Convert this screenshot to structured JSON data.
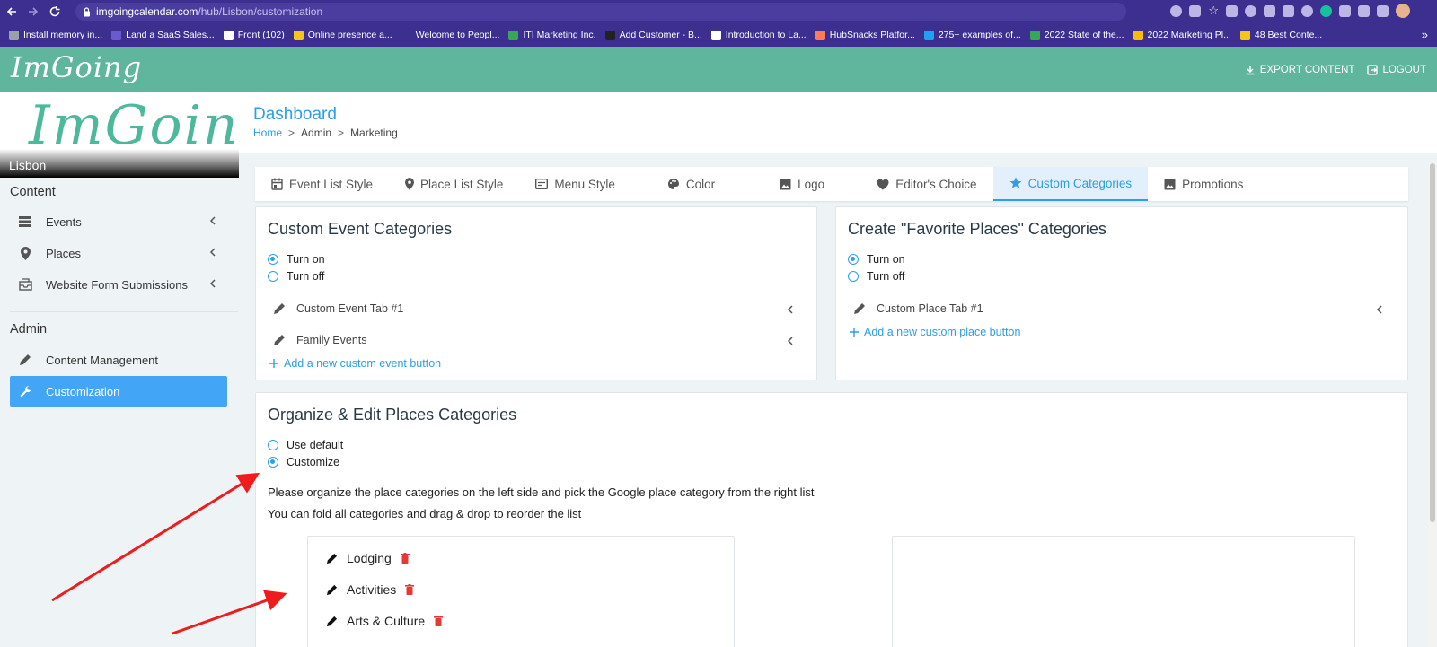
{
  "browser": {
    "url_host": "imgoingcalendar.com",
    "url_path": "/hub/Lisbon/customization",
    "bookmarks": [
      {
        "label": "Install memory in...",
        "color": "#9aa0a6"
      },
      {
        "label": "Land a SaaS Sales...",
        "color": "#6a5acd"
      },
      {
        "label": "Front (102)",
        "color": "#ffffff"
      },
      {
        "label": "Online presence a...",
        "color": "#f5c518"
      },
      {
        "label": "Welcome to Peopl...",
        "color": "#3c2f8f"
      },
      {
        "label": "ITI Marketing Inc.",
        "color": "#34a853"
      },
      {
        "label": "Add Customer - B...",
        "color": "#222222"
      },
      {
        "label": "Introduction to La...",
        "color": "#ffffff"
      },
      {
        "label": "HubSnacks Platfor...",
        "color": "#ff7a59"
      },
      {
        "label": "275+ examples of...",
        "color": "#1da1f2"
      },
      {
        "label": "2022 State of the...",
        "color": "#34a853"
      },
      {
        "label": "2022 Marketing Pl...",
        "color": "#fbbc04"
      },
      {
        "label": "48 Best Conte...",
        "color": "#f5c518"
      }
    ],
    "more": "»"
  },
  "app": {
    "brand": "ImGoing",
    "export_label": "EXPORT CONTENT",
    "logout_label": "LOGOUT"
  },
  "sidebar": {
    "logo_text": "ImGoing",
    "city": "Lisbon",
    "content_heading": "Content",
    "content_items": [
      {
        "label": "Events",
        "icon": "list-icon"
      },
      {
        "label": "Places",
        "icon": "map-pin-icon"
      },
      {
        "label": "Website Form Submissions",
        "icon": "inbox-icon"
      }
    ],
    "admin_heading": "Admin",
    "admin_items": [
      {
        "label": "Content Management",
        "icon": "pencil-icon"
      },
      {
        "label": "Customization",
        "icon": "wrench-icon",
        "active": true
      }
    ]
  },
  "page": {
    "title": "Dashboard",
    "breadcrumb": [
      "Home",
      "Admin",
      "Marketing"
    ]
  },
  "tabs": [
    {
      "label": "Event List Style",
      "icon": "calendar-icon"
    },
    {
      "label": "Place List Style",
      "icon": "map-pin-icon"
    },
    {
      "label": "Menu Style",
      "icon": "menu-card-icon"
    },
    {
      "label": "Color",
      "icon": "palette-icon"
    },
    {
      "label": "Logo",
      "icon": "image-icon"
    },
    {
      "label": "Editor's Choice",
      "icon": "heart-icon"
    },
    {
      "label": "Custom Categories",
      "icon": "star-icon",
      "active": true
    },
    {
      "label": "Promotions",
      "icon": "image-icon"
    }
  ],
  "custom_event": {
    "title": "Custom Event Categories",
    "options": [
      "Turn on",
      "Turn off"
    ],
    "selected": "Turn on",
    "items": [
      "Custom Event Tab #1",
      "Family Events"
    ],
    "add_label": "Add a new custom event button"
  },
  "favorite_places": {
    "title": "Create \"Favorite Places\" Categories",
    "options": [
      "Turn on",
      "Turn off"
    ],
    "selected": "Turn on",
    "items": [
      "Custom Place Tab #1"
    ],
    "add_label": "Add a new custom place button"
  },
  "organize": {
    "title": "Organize & Edit Places Categories",
    "options": [
      "Use default",
      "Customize"
    ],
    "selected": "Customize",
    "desc1": "Please organize the place categories on the left side and pick the Google place category from the right list",
    "desc2": "You can fold all categories and drag & drop to reorder the list",
    "categories": [
      "Lodging",
      "Activities",
      "Arts & Culture"
    ]
  },
  "colors": {
    "accent": "#2d9ee8",
    "header": "#5fb69c",
    "active_nav": "#42a5f5",
    "delete": "#e53935",
    "annotation_arrow": "#ee1c1c"
  }
}
